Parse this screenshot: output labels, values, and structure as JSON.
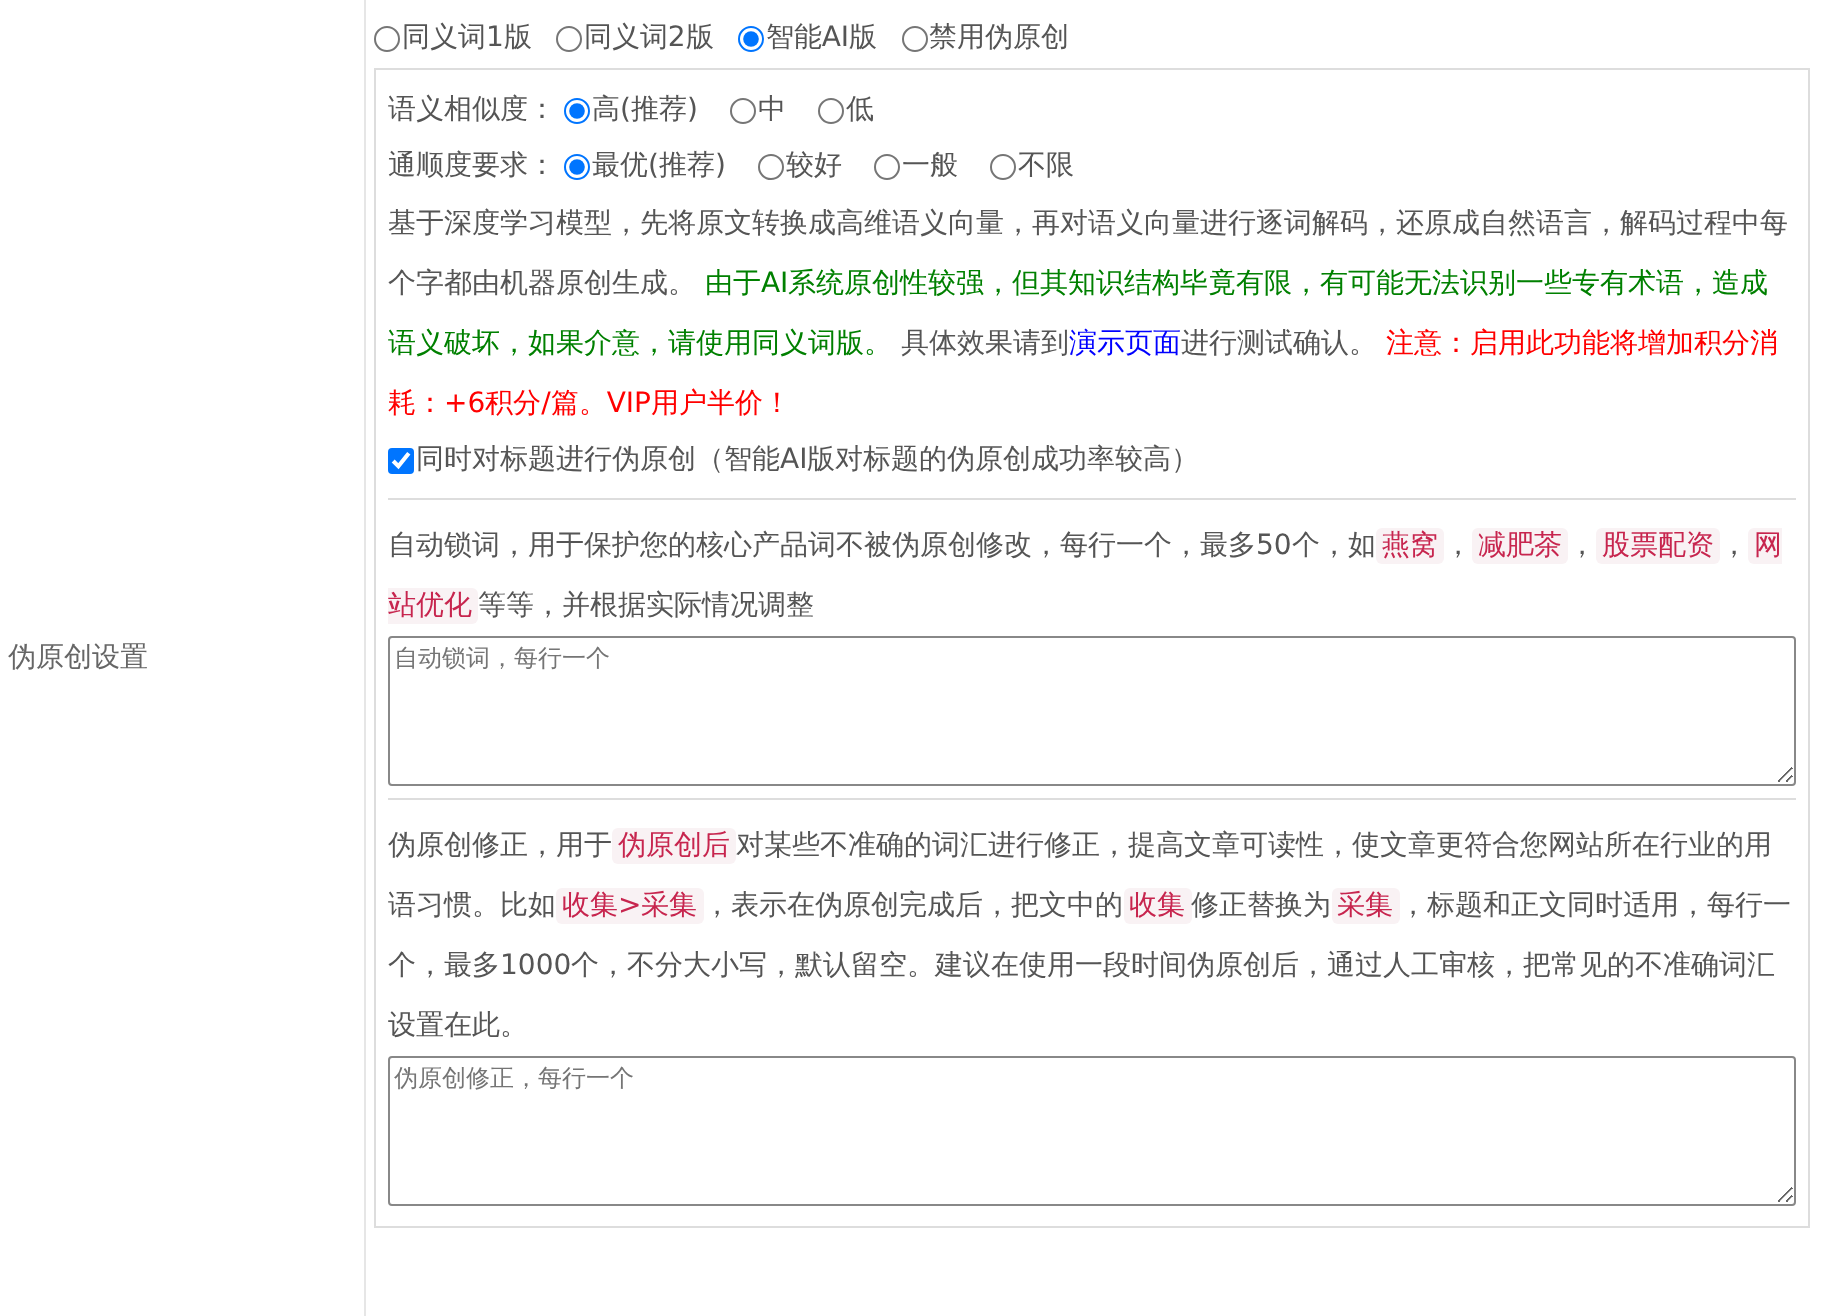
{
  "section_label": "伪原创设置",
  "modes": [
    {
      "label": "同义词1版",
      "selected": false
    },
    {
      "label": "同义词2版",
      "selected": false
    },
    {
      "label": "智能AI版",
      "selected": true
    },
    {
      "label": "禁用伪原创",
      "selected": false
    }
  ],
  "similarity": {
    "label": "语义相似度：",
    "options": [
      {
        "label": "高(推荐)",
        "selected": true
      },
      {
        "label": "中",
        "selected": false
      },
      {
        "label": "低",
        "selected": false
      }
    ]
  },
  "fluency": {
    "label": "通顺度要求：",
    "options": [
      {
        "label": "最优(推荐)",
        "selected": true
      },
      {
        "label": "较好",
        "selected": false
      },
      {
        "label": "一般",
        "selected": false
      },
      {
        "label": "不限",
        "selected": false
      }
    ]
  },
  "ai_description": [
    {
      "kind": "plain",
      "text": "基于深度学习模型，先将原文转换成高维语义向量，再对语义向量进行逐词解码，还原成自然语言，解码过程中每个字都由机器原创生成。 "
    },
    {
      "kind": "green",
      "text": "由于AI系统原创性较强，但其知识结构毕竟有限，有可能无法识别一些专有术语，造成语义破坏，如果介意，请使用同义词版。"
    },
    {
      "kind": "plain",
      "text": " 具体效果请到"
    },
    {
      "kind": "link",
      "text": "演示页面"
    },
    {
      "kind": "plain",
      "text": "进行测试确认。 "
    },
    {
      "kind": "red",
      "text": "注意：启用此功能将增加积分消耗：+6积分/篇。VIP用户半价！"
    }
  ],
  "title_option": {
    "label": "同时对标题进行伪原创（智能AI版对标题的伪原创成功率较高）",
    "checked": true
  },
  "lock_description": [
    {
      "kind": "plain",
      "text": "自动锁词，用于保护您的核心产品词不被伪原创修改，每行一个，最多50个，如"
    },
    {
      "kind": "code",
      "text": "燕窝"
    },
    {
      "kind": "plain",
      "text": "，"
    },
    {
      "kind": "code",
      "text": "减肥茶"
    },
    {
      "kind": "plain",
      "text": "，"
    },
    {
      "kind": "code",
      "text": "股票配资"
    },
    {
      "kind": "plain",
      "text": "，"
    },
    {
      "kind": "code",
      "text": "网站优化"
    },
    {
      "kind": "plain",
      "text": "等等，并根据实际情况调整"
    }
  ],
  "lock_field": {
    "placeholder": "自动锁词，每行一个"
  },
  "fix_description": [
    {
      "kind": "plain",
      "text": "伪原创修正，用于"
    },
    {
      "kind": "code",
      "text": "伪原创后"
    },
    {
      "kind": "plain",
      "text": "对某些不准确的词汇进行修正，提高文章可读性，使文章更符合您网站所在行业的用语习惯。比如"
    },
    {
      "kind": "code",
      "text": "收集>采集"
    },
    {
      "kind": "plain",
      "text": "，表示在伪原创完成后，把文中的"
    },
    {
      "kind": "code",
      "text": "收集"
    },
    {
      "kind": "plain",
      "text": "修正替换为"
    },
    {
      "kind": "code",
      "text": "采集"
    },
    {
      "kind": "plain",
      "text": "，标题和正文同时适用，每行一个，最多1000个，不分大小写，默认留空。建议在使用一段时间伪原创后，通过人工审核，把常见的不准确词汇设置在此。"
    }
  ],
  "fix_field": {
    "placeholder": "伪原创修正，每行一个"
  }
}
